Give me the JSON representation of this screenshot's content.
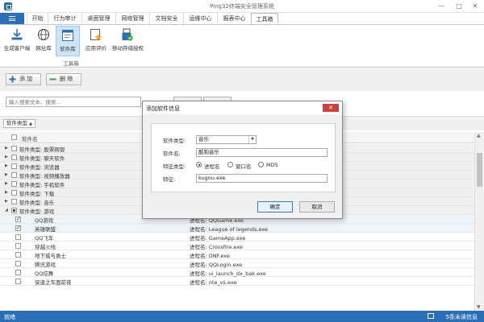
{
  "window": {
    "title": "Ping32终端安全管理系统",
    "minimize": "—",
    "maximize": "□",
    "close": "✕"
  },
  "tabs": [
    "开始",
    "行为审计",
    "桌面管理",
    "网络管理",
    "文档安全",
    "运维中心",
    "报表中心",
    "工具箱"
  ],
  "ribbon": {
    "buttons": [
      "生成客户端",
      "网址库",
      "软件库",
      "应用评价",
      "移动存储授权"
    ],
    "group_label": "工具箱"
  },
  "toolbar": {
    "add": "添 加",
    "delete": "删 除"
  },
  "search": {
    "placeholder": "输入搜索文本、搜索..."
  },
  "group_by": {
    "label": "软件类型",
    "arrow": "▲"
  },
  "grid": {
    "header": "软件名",
    "groups": [
      "软件类型: 股票网银",
      "软件类型: 聊天软件",
      "软件类型: 浏览器",
      "软件类型: 视频播放器",
      "软件类型: 手机软件",
      "软件类型: 下载",
      "软件类型: 音乐",
      "软件类型: 游戏"
    ],
    "rows": [
      {
        "name": "QQ游戏",
        "feature": "进程名: QQGame.exe",
        "checked": true
      },
      {
        "name": "英雄联盟",
        "feature": "进程名: League of legends.exe",
        "checked": true
      },
      {
        "name": "QQ飞车",
        "feature": "进程名: GameApp.exe",
        "checked": false
      },
      {
        "name": "穿越火线",
        "feature": "进程名: Crossfire.exe",
        "checked": false
      },
      {
        "name": "地下城与勇士",
        "feature": "进程名: DNF.exe",
        "checked": false
      },
      {
        "name": "腾讯游戏",
        "feature": "进程名: QQLogin.exe",
        "checked": false
      },
      {
        "name": "QQ炫舞",
        "feature": "进程名: ui_launch_dx_bak.exe",
        "checked": false
      },
      {
        "name": "侠道之车面前夜",
        "feature": "进程名: nte_vs.exe",
        "checked": false
      }
    ]
  },
  "status": {
    "left": "就绪",
    "right": "5条未读信息"
  },
  "dialog": {
    "title": "添加软件信息",
    "close": "✕",
    "type_label": "软件类型:",
    "type_value": "音乐",
    "name_label": "软件名:",
    "name_value": "酷狗音乐",
    "feature_type_label": "特征类型:",
    "radio_options": [
      "进程名",
      "窗口名",
      "MD5"
    ],
    "selected_radio": "进程名",
    "feature_label": "特征:",
    "feature_value": "kugou.exe",
    "ok": "确定",
    "cancel": "取消"
  },
  "colors": {
    "accent": "#2b6fb6",
    "close_red": "#c9433a",
    "active_ribbon": "#cce4f7"
  }
}
